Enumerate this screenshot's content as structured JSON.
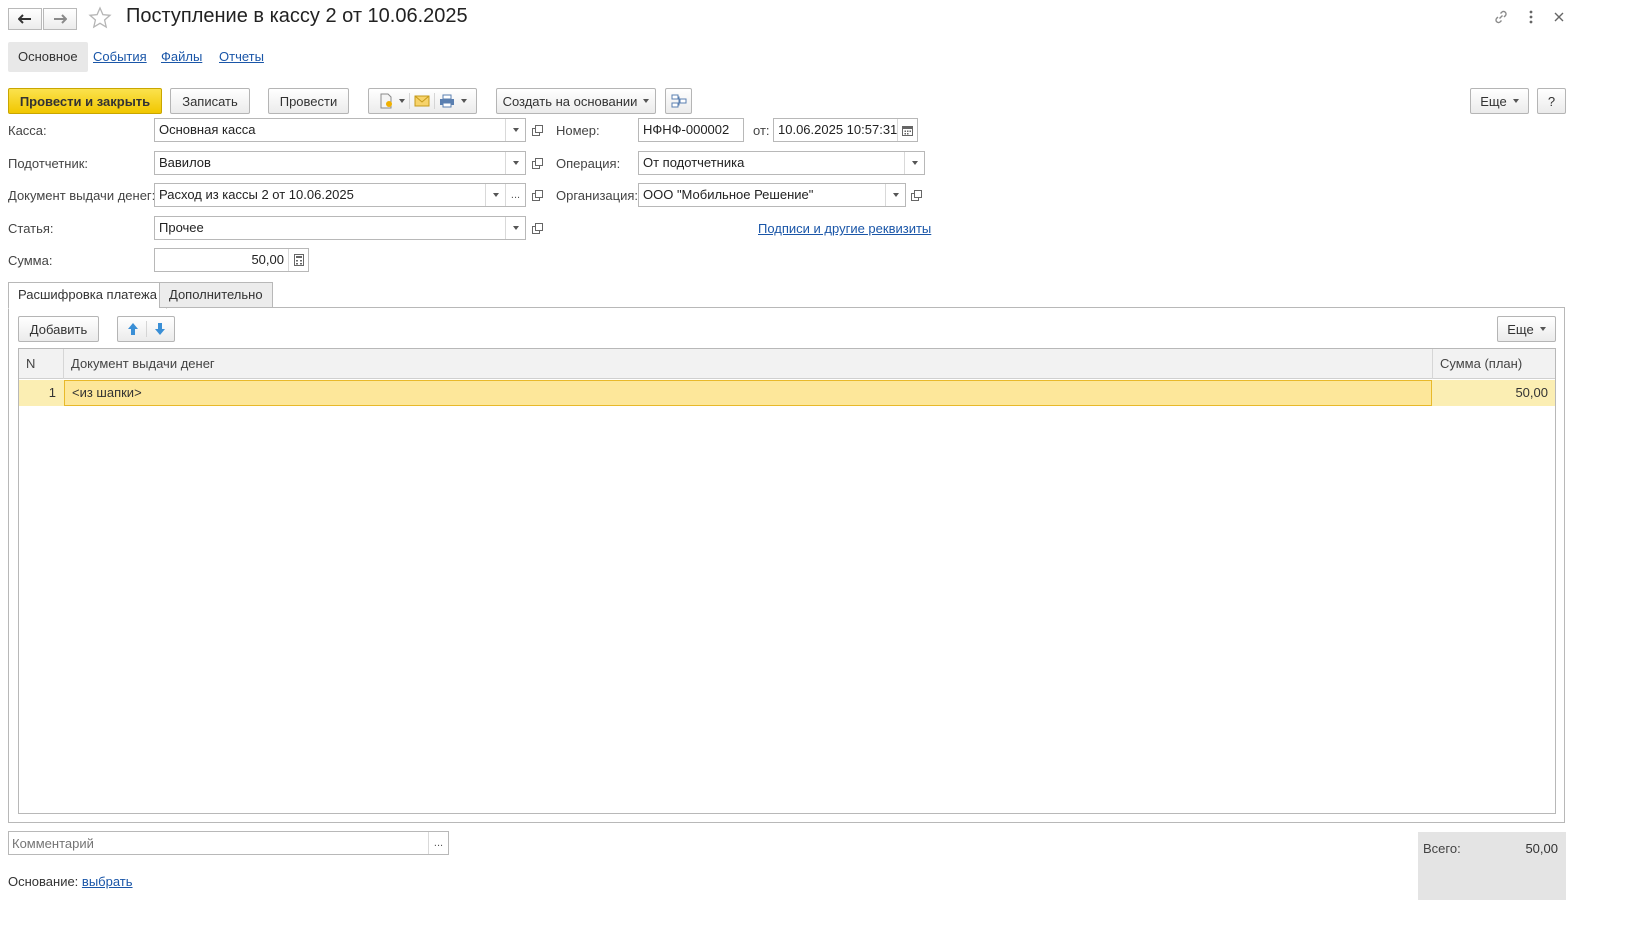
{
  "window": {
    "title": "Поступление в кассу 2 от 10.06.2025"
  },
  "sections": [
    {
      "label": "Основное",
      "active": true
    },
    {
      "label": "События"
    },
    {
      "label": "Файлы"
    },
    {
      "label": "Отчеты"
    }
  ],
  "toolbar": {
    "post_and_close": "Провести и закрыть",
    "save": "Записать",
    "post": "Провести",
    "create_based_on": "Создать на основании",
    "more": "Еще",
    "help": "?"
  },
  "form": {
    "kassa": {
      "label": "Касса:",
      "value": "Основная касса"
    },
    "podotchetnik": {
      "label": "Подотчетник:",
      "value": "Вавилов"
    },
    "doc_vydachi": {
      "label": "Документ выдачи денег:",
      "value": "Расход из кассы 2 от 10.06.2025"
    },
    "statya": {
      "label": "Статья:",
      "value": "Прочее"
    },
    "summa": {
      "label": "Сумма:",
      "value": "50,00"
    },
    "nomer": {
      "label": "Номер:",
      "value": "НФНФ-000002"
    },
    "date": {
      "label": "от:",
      "value": "10.06.2025 10:57:31"
    },
    "operaciya": {
      "label": "Операция:",
      "value": "От подотчетника"
    },
    "organizaciya": {
      "label": "Организация:",
      "value": "ООО \"Мобильное Решение\""
    },
    "signatures_link": "Подписи и другие реквизиты"
  },
  "tabs": [
    {
      "label": "Расшифровка платежа",
      "active": true
    },
    {
      "label": "Дополнительно"
    }
  ],
  "table_toolbar": {
    "add": "Добавить",
    "more": "Еще"
  },
  "table": {
    "columns": [
      "N",
      "Документ выдачи денег",
      "Сумма (план)"
    ],
    "rows": [
      {
        "n": "1",
        "doc": "<из шапки>",
        "sum": "50,00"
      }
    ]
  },
  "footer": {
    "comment_placeholder": "Комментарий",
    "osnovanie_label": "Основание:",
    "osnovanie_link": "выбрать",
    "total_label": "Всего:",
    "total_value": "50,00"
  },
  "colors": {
    "primary_button": "#f1c700",
    "link": "#1a56a8",
    "selected_row": "#fbeeb3"
  }
}
